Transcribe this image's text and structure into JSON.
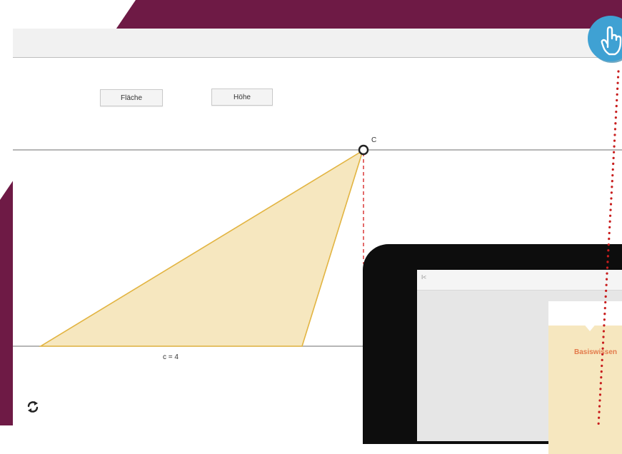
{
  "buttons": {
    "flaeche_label": "Fläche",
    "hoehe_label": "Höhe"
  },
  "geometry": {
    "vertex_label": "C",
    "side_label": "c = 4"
  },
  "tablet": {
    "topbar_label": "I<",
    "card_label": "Basiswissen"
  },
  "icons": {
    "refresh": "refresh-icon",
    "hand_pointer": "hand-pointer-icon"
  },
  "colors": {
    "background_dark": "#6e1a45",
    "triangle_fill": "#f6e7bf",
    "triangle_stroke": "#e2b441",
    "height_line": "#e05a5a",
    "badge_blue": "#3fa1d3",
    "dotted_red": "#c81e1e",
    "card_accent": "#e37a4b"
  }
}
